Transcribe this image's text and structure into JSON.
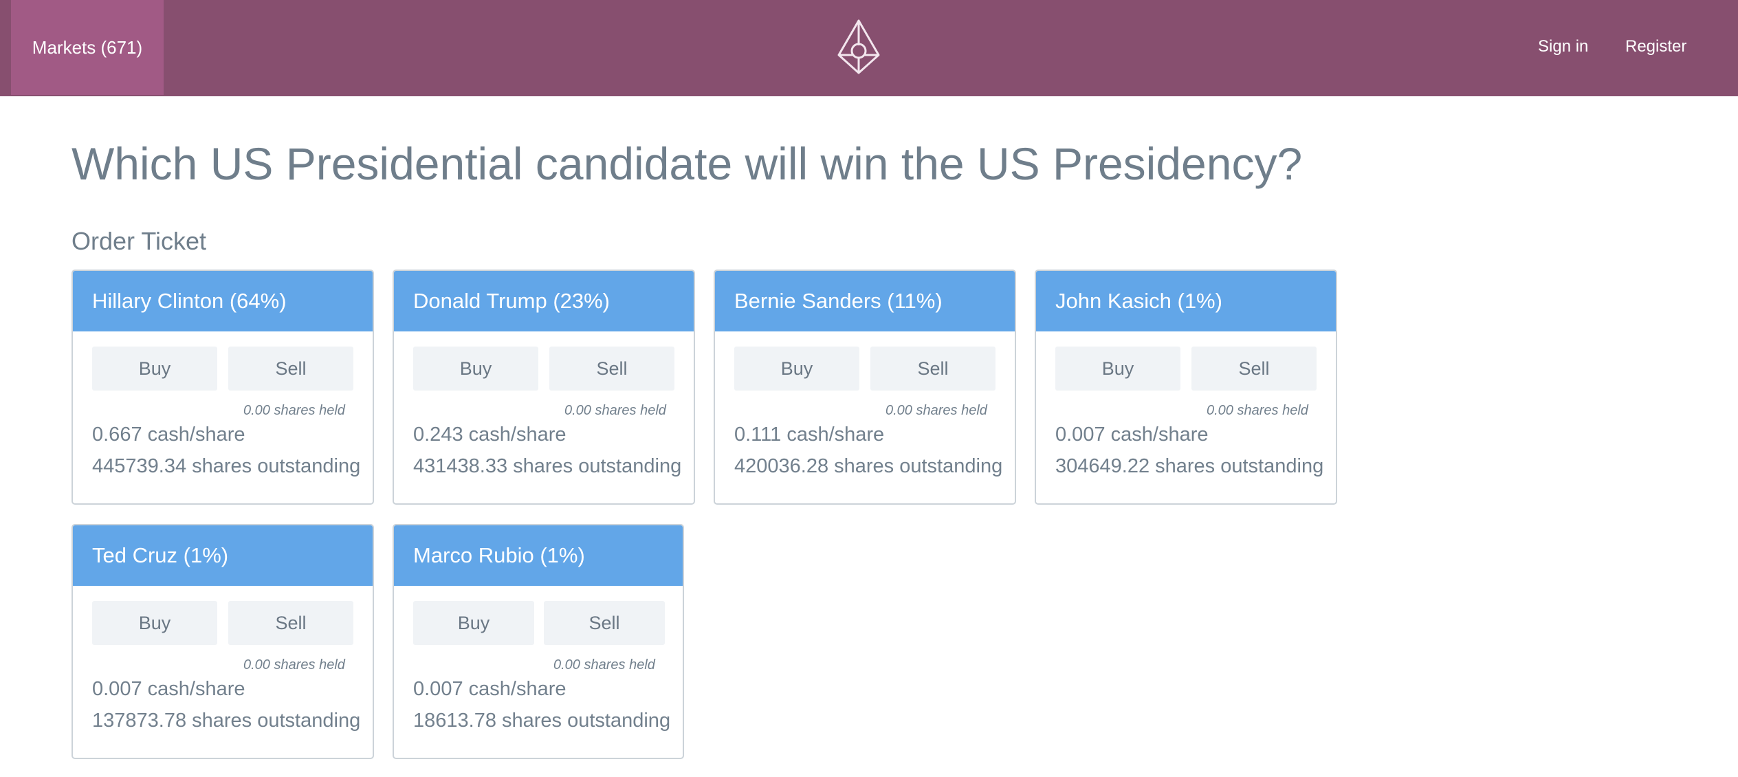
{
  "header": {
    "markets_label": "Markets (671)",
    "logo_icon": "augur-logo-icon",
    "signin_label": "Sign in",
    "register_label": "Register",
    "bar_color": "#874f6f",
    "active_tab_color": "#a15a85"
  },
  "page": {
    "title": "Which US Presidential candidate will win the US Presidency?",
    "section_title": "Order Ticket"
  },
  "outcomes": [
    {
      "name": "Hillary Clinton (64%)",
      "buy": "Buy",
      "sell": "Sell",
      "shares_held": "0.00 shares held",
      "cash_per_share": "0.667 cash/share",
      "outstanding": "445739.34 shares outstanding"
    },
    {
      "name": "Donald Trump (23%)",
      "buy": "Buy",
      "sell": "Sell",
      "shares_held": "0.00 shares held",
      "cash_per_share": "0.243 cash/share",
      "outstanding": "431438.33 shares outstanding"
    },
    {
      "name": "Bernie Sanders (11%)",
      "buy": "Buy",
      "sell": "Sell",
      "shares_held": "0.00 shares held",
      "cash_per_share": "0.111 cash/share",
      "outstanding": "420036.28 shares outstanding"
    },
    {
      "name": "John Kasich (1%)",
      "buy": "Buy",
      "sell": "Sell",
      "shares_held": "0.00 shares held",
      "cash_per_share": "0.007 cash/share",
      "outstanding": "304649.22 shares outstanding"
    },
    {
      "name": "Ted Cruz (1%)",
      "buy": "Buy",
      "sell": "Sell",
      "shares_held": "0.00 shares held",
      "cash_per_share": "0.007 cash/share",
      "outstanding": "137873.78 shares outstanding"
    },
    {
      "name": "Marco Rubio (1%)",
      "buy": "Buy",
      "sell": "Sell",
      "shares_held": "0.00 shares held",
      "cash_per_share": "0.007 cash/share",
      "outstanding": "18613.78 shares outstanding"
    }
  ]
}
